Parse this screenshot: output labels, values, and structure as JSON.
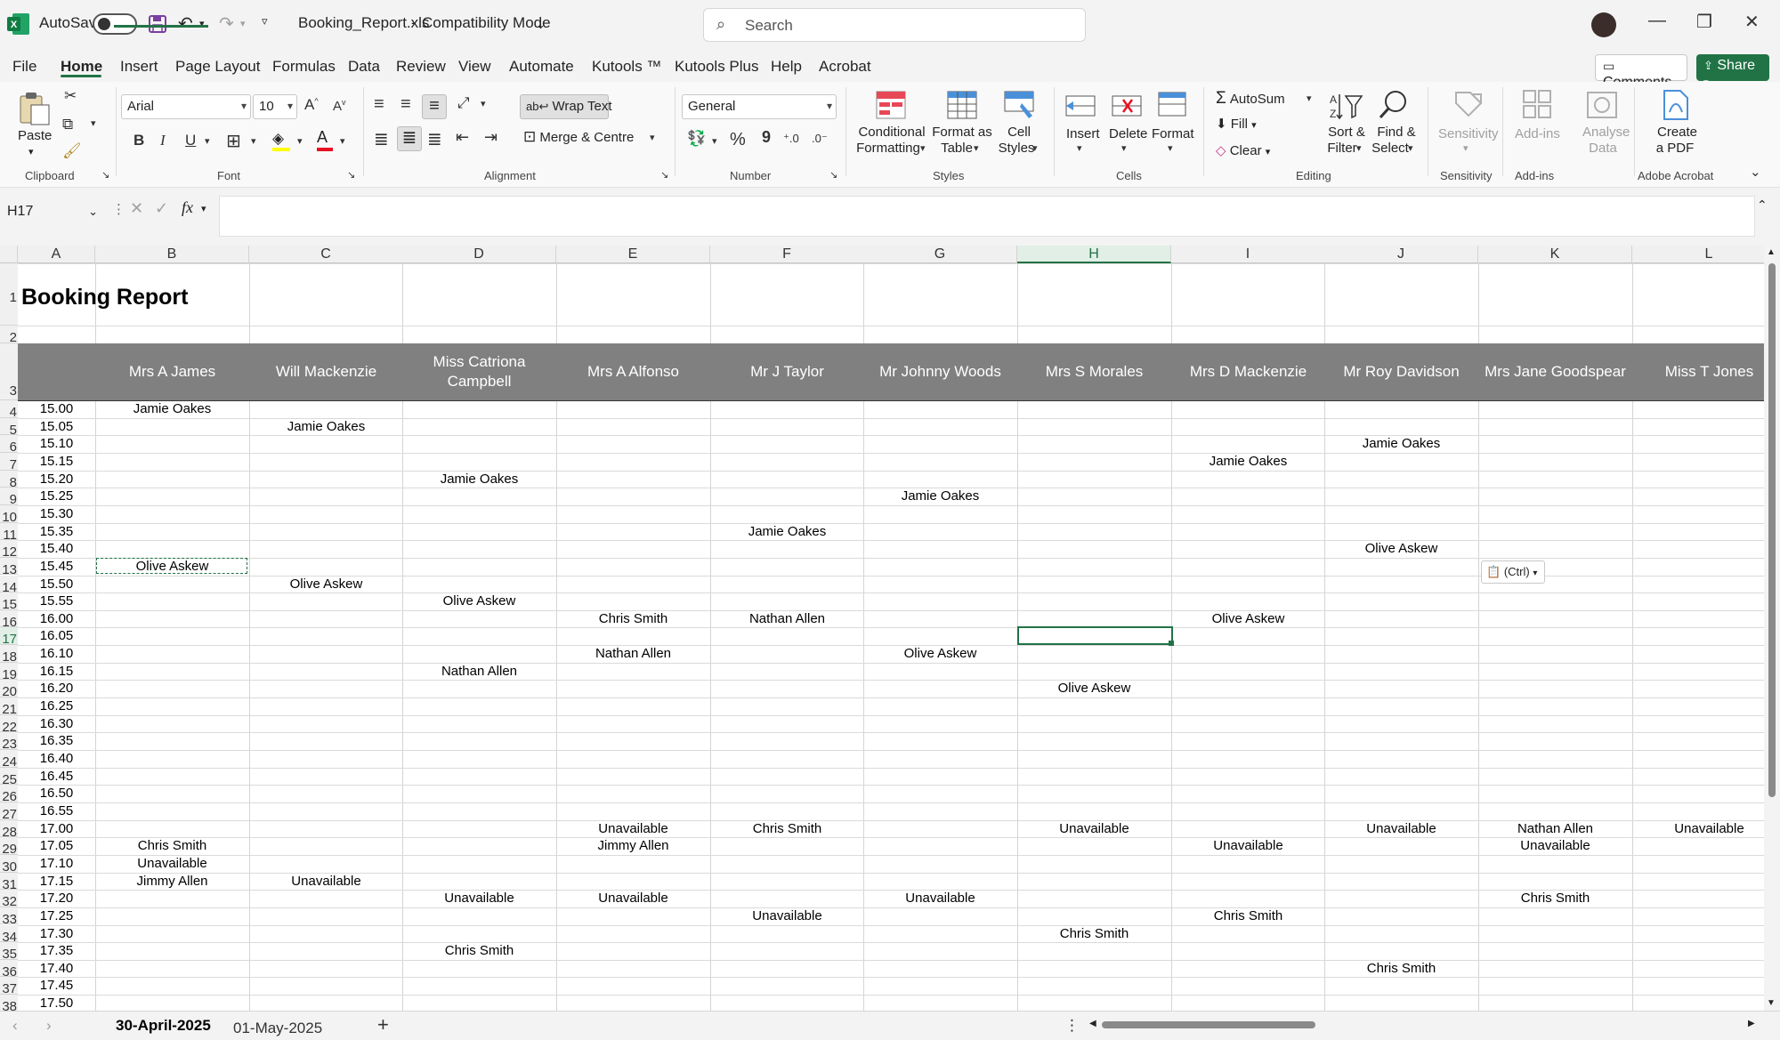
{
  "titlebar": {
    "autosave_label": "AutoSave",
    "file_name": "Booking_Report.xls",
    "separator": "-",
    "mode": "Compatibility Mode",
    "search_placeholder": "Search"
  },
  "menu": {
    "items": [
      "File",
      "Home",
      "Insert",
      "Page Layout",
      "Formulas",
      "Data",
      "Review",
      "View",
      "Automate",
      "Kutools ™",
      "Kutools Plus",
      "Help",
      "Acrobat"
    ],
    "active": "Home",
    "comments_label": "Comments",
    "share_label": "Share"
  },
  "ribbon": {
    "paste_label": "Paste",
    "font_name": "Arial",
    "font_size": "10",
    "wrap_text": "Wrap Text",
    "merge_centre": "Merge & Centre",
    "number_format": "General",
    "conditional_formatting": [
      "Conditional",
      "Formatting"
    ],
    "format_as_table": [
      "Format as",
      "Table"
    ],
    "cell_styles": [
      "Cell",
      "Styles"
    ],
    "insert": "Insert",
    "delete": "Delete",
    "format": "Format",
    "autosum": "AutoSum",
    "fill": "Fill",
    "clear": "Clear",
    "sort_filter": [
      "Sort &",
      "Filter"
    ],
    "find_select": [
      "Find &",
      "Select"
    ],
    "sensitivity": "Sensitivity",
    "addins": "Add-ins",
    "analyse_data": [
      "Analyse",
      "Data"
    ],
    "create_pdf": [
      "Create",
      "a PDF"
    ],
    "groups": {
      "clipboard": "Clipboard",
      "font": "Font",
      "alignment": "Alignment",
      "number": "Number",
      "styles": "Styles",
      "cells": "Cells",
      "editing": "Editing",
      "sensitivity": "Sensitivity",
      "addins": "Add-ins",
      "adobe": "Adobe Acrobat"
    },
    "bold": "B",
    "italic": "I",
    "underline": "U",
    "percent": "%",
    "comma": "9"
  },
  "formula": {
    "name_box": "H17",
    "fx": "fx",
    "content": ""
  },
  "sheet": {
    "columns": [
      "A",
      "B",
      "C",
      "D",
      "E",
      "F",
      "G",
      "H",
      "I",
      "J",
      "K",
      "L"
    ],
    "selected_column": "H",
    "selected_row": "17",
    "title": "Booking Report",
    "headers": [
      "Mrs A James",
      "Will Mackenzie",
      "Miss Catriona Campbell",
      "Mrs A Alfonso",
      "Mr J Taylor",
      "Mr Johnny Woods",
      "Mrs S Morales",
      "Mrs D Mackenzie",
      "Mr Roy Davidson",
      "Mrs Jane Goodspear",
      "Miss T Jones"
    ],
    "header_line1_d": "Miss Catriona",
    "header_line2_d": "Campbell",
    "times": [
      "15.00",
      "15.05",
      "15.10",
      "15.15",
      "15.20",
      "15.25",
      "15.30",
      "15.35",
      "15.40",
      "15.45",
      "15.50",
      "15.55",
      "16.00",
      "16.05",
      "16.10",
      "16.15",
      "16.20",
      "16.25",
      "16.30",
      "16.35",
      "16.40",
      "16.45",
      "16.50",
      "16.55",
      "17.00",
      "17.05",
      "17.10",
      "17.15",
      "17.20",
      "17.25",
      "17.30",
      "17.35",
      "17.40",
      "17.45",
      "17.50"
    ],
    "row_numbers": [
      "1",
      "2",
      "3",
      "4",
      "5",
      "6",
      "7",
      "8",
      "9",
      "10",
      "11",
      "12",
      "13",
      "14",
      "15",
      "16",
      "17",
      "18",
      "19",
      "20",
      "21",
      "22",
      "23",
      "24",
      "25",
      "26",
      "27",
      "28",
      "29",
      "30",
      "31",
      "32",
      "33",
      "34",
      "35",
      "36",
      "37",
      "38"
    ],
    "bookings": [
      {
        "row": 4,
        "col": "B",
        "text": "Jamie Oakes"
      },
      {
        "row": 5,
        "col": "C",
        "text": "Jamie Oakes"
      },
      {
        "row": 6,
        "col": "J",
        "text": "Jamie Oakes"
      },
      {
        "row": 7,
        "col": "I",
        "text": "Jamie Oakes"
      },
      {
        "row": 8,
        "col": "D",
        "text": "Jamie Oakes"
      },
      {
        "row": 9,
        "col": "G",
        "text": "Jamie Oakes"
      },
      {
        "row": 11,
        "col": "F",
        "text": "Jamie Oakes"
      },
      {
        "row": 12,
        "col": "J",
        "text": "Olive Askew"
      },
      {
        "row": 13,
        "col": "B",
        "text": "Olive Askew"
      },
      {
        "row": 14,
        "col": "C",
        "text": "Olive Askew"
      },
      {
        "row": 15,
        "col": "D",
        "text": "Olive Askew"
      },
      {
        "row": 16,
        "col": "E",
        "text": "Chris Smith"
      },
      {
        "row": 16,
        "col": "F",
        "text": "Nathan Allen"
      },
      {
        "row": 16,
        "col": "I",
        "text": "Olive Askew"
      },
      {
        "row": 18,
        "col": "E",
        "text": "Nathan Allen"
      },
      {
        "row": 18,
        "col": "G",
        "text": "Olive Askew"
      },
      {
        "row": 19,
        "col": "D",
        "text": "Nathan Allen"
      },
      {
        "row": 20,
        "col": "H",
        "text": "Olive Askew"
      },
      {
        "row": 28,
        "col": "E",
        "text": "Unavailable"
      },
      {
        "row": 28,
        "col": "F",
        "text": "Chris Smith"
      },
      {
        "row": 28,
        "col": "H",
        "text": "Unavailable"
      },
      {
        "row": 28,
        "col": "J",
        "text": "Unavailable"
      },
      {
        "row": 28,
        "col": "K",
        "text": "Nathan Allen"
      },
      {
        "row": 28,
        "col": "L",
        "text": "Unavailable"
      },
      {
        "row": 29,
        "col": "B",
        "text": "Chris Smith"
      },
      {
        "row": 29,
        "col": "E",
        "text": "Jimmy Allen"
      },
      {
        "row": 29,
        "col": "I",
        "text": "Unavailable"
      },
      {
        "row": 29,
        "col": "K",
        "text": "Unavailable"
      },
      {
        "row": 30,
        "col": "B",
        "text": "Unavailable"
      },
      {
        "row": 31,
        "col": "B",
        "text": "Jimmy Allen"
      },
      {
        "row": 31,
        "col": "C",
        "text": "Unavailable"
      },
      {
        "row": 32,
        "col": "D",
        "text": "Unavailable"
      },
      {
        "row": 32,
        "col": "E",
        "text": "Unavailable"
      },
      {
        "row": 32,
        "col": "G",
        "text": "Unavailable"
      },
      {
        "row": 32,
        "col": "K",
        "text": "Chris Smith"
      },
      {
        "row": 33,
        "col": "F",
        "text": "Unavailable"
      },
      {
        "row": 33,
        "col": "I",
        "text": "Chris Smith"
      },
      {
        "row": 34,
        "col": "H",
        "text": "Chris Smith"
      },
      {
        "row": 35,
        "col": "D",
        "text": "Chris Smith"
      },
      {
        "row": 36,
        "col": "J",
        "text": "Chris Smith"
      }
    ],
    "paste_options_label": "(Ctrl)"
  },
  "tabs": {
    "items": [
      "30-April-2025",
      "01-May-2025"
    ],
    "active": "30-April-2025",
    "add_label": "+"
  },
  "colors": {
    "accent": "#217346",
    "header_band": "#808080",
    "share": "#217346"
  }
}
